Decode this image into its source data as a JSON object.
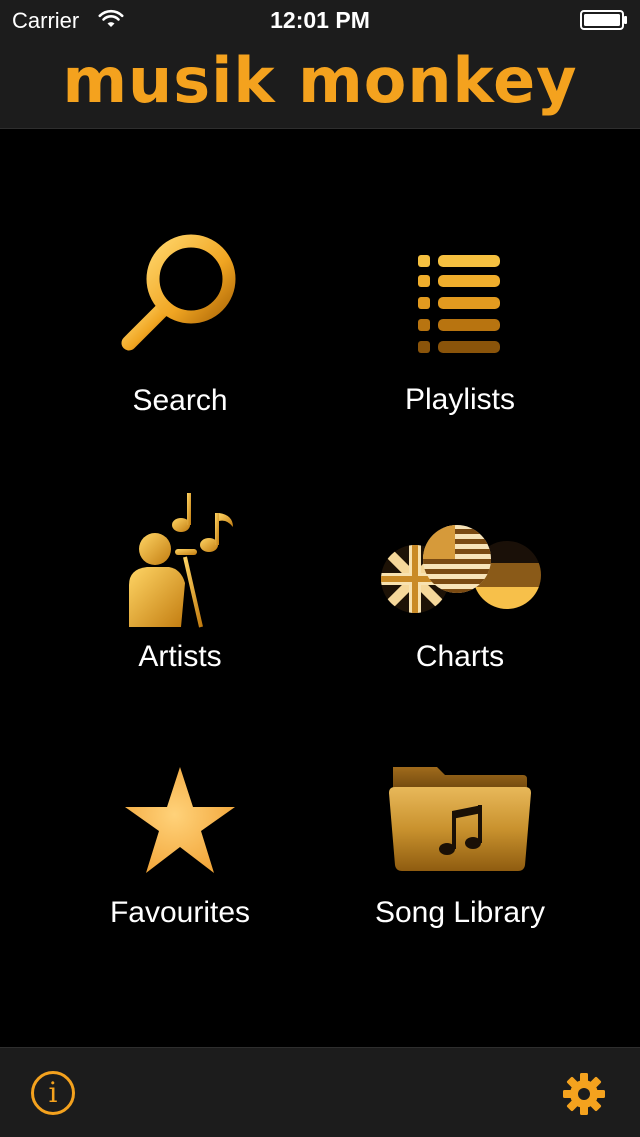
{
  "status_bar": {
    "carrier": "Carrier",
    "time": "12:01 PM"
  },
  "header": {
    "title": "musik monkey"
  },
  "menu": {
    "items": [
      {
        "label": "Search",
        "icon": "magnifier-icon"
      },
      {
        "label": "Playlists",
        "icon": "list-icon"
      },
      {
        "label": "Artists",
        "icon": "singer-icon"
      },
      {
        "label": "Charts",
        "icon": "flags-icon"
      },
      {
        "label": "Favourites",
        "icon": "star-icon"
      },
      {
        "label": "Song Library",
        "icon": "music-folder-icon"
      }
    ]
  },
  "toolbar": {
    "info_glyph": "i"
  },
  "colors": {
    "accent": "#f4a21e",
    "bar_background": "#1c1c1c",
    "background": "#000000"
  }
}
